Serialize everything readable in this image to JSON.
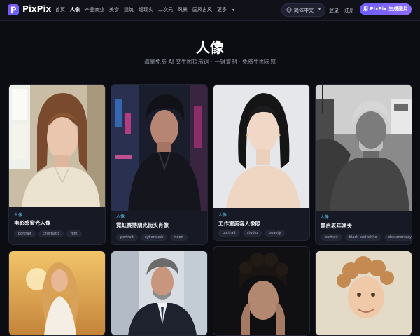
{
  "brand": {
    "name": "PixPix"
  },
  "nav": {
    "items": [
      {
        "label": "首页",
        "active": false
      },
      {
        "label": "人像",
        "active": true
      },
      {
        "label": "产品商业",
        "active": false
      },
      {
        "label": "美食",
        "active": false
      },
      {
        "label": "建筑",
        "active": false
      },
      {
        "label": "超现实",
        "active": false
      },
      {
        "label": "二次元",
        "active": false
      },
      {
        "label": "风景",
        "active": false
      },
      {
        "label": "国风古风",
        "active": false
      },
      {
        "label": "更多",
        "active": false
      }
    ],
    "language": "简体中文",
    "login": "登录",
    "register": "注册",
    "cta": "用 PixPix 生成图片"
  },
  "hero": {
    "title": "人像",
    "subtitle": "海量免费 AI 文生图提示词 · 一键复制 · 免费生图灵感"
  },
  "cards": [
    {
      "category": "人像",
      "title": "电影感窗光人像",
      "tags": [
        "portrait",
        "cinematic",
        "film"
      ]
    },
    {
      "category": "人像",
      "title": "霓虹赛博朋克街头肖像",
      "tags": [
        "portrait",
        "cyberpunk",
        "neon"
      ]
    },
    {
      "category": "人像",
      "title": "工作室美容人像照",
      "tags": [
        "portrait",
        "studio",
        "beauty"
      ]
    },
    {
      "category": "人像",
      "title": "黑白老年渔夫",
      "tags": [
        "portrait",
        "black-and-white",
        "documentary"
      ]
    }
  ],
  "colors": {
    "accent": "#6d5cff",
    "category": "#5fd0ff",
    "background": "#0c0d13"
  }
}
